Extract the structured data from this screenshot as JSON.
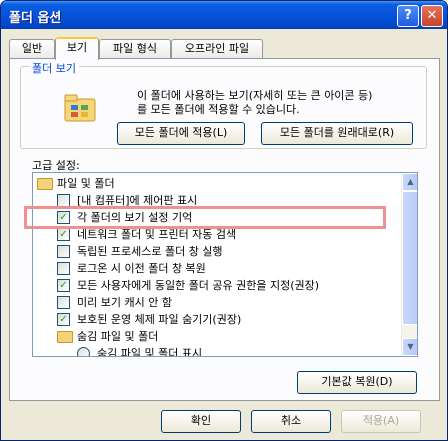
{
  "window": {
    "title": "폴더 옵션",
    "help_label": "?",
    "close_label": "✕"
  },
  "tabs": [
    {
      "label": "일반"
    },
    {
      "label": "보기"
    },
    {
      "label": "파일 형식"
    },
    {
      "label": "오프라인 파일"
    }
  ],
  "folder_views": {
    "title": "폴더 보기",
    "description_line1": "이 폴더에 사용하는 보기(자세히 또는 큰 아이콘 등)",
    "description_line2": "를 모든 폴더에 적용할 수 있습니다.",
    "apply_button": "모든 폴더에 적용(L)",
    "reset_button": "모든 폴더를 원래대로(R)"
  },
  "advanced": {
    "label": "고급 설정:",
    "items": [
      {
        "type": "folder",
        "label": "파일 및 폴더"
      },
      {
        "type": "checkbox",
        "checked": false,
        "label": "[내 컴퓨터]에 제어판 표시"
      },
      {
        "type": "checkbox",
        "checked": true,
        "label": "각 폴더의 보기 설정 기억"
      },
      {
        "type": "checkbox",
        "checked": true,
        "label": "네트워크 폴더 및 프린터 자동 검색"
      },
      {
        "type": "checkbox",
        "checked": false,
        "label": "독립된 프로세스로 폴더 창 실행"
      },
      {
        "type": "checkbox",
        "checked": false,
        "label": "로그온 시 이전 폴더 창 복원"
      },
      {
        "type": "checkbox",
        "checked": true,
        "label": "모든 사용자에게 동일한 폴더 공유 권한을 지정(권장)"
      },
      {
        "type": "checkbox",
        "checked": false,
        "label": "미리 보기 캐시 안 함"
      },
      {
        "type": "checkbox",
        "checked": true,
        "label": "보호된 운영 체제 파일 숨기기(권장)"
      },
      {
        "type": "folder",
        "label": "숨김 파일 및 폴더"
      },
      {
        "type": "radio",
        "checked": false,
        "label": "숨김 파일 및 폴더 표시"
      }
    ],
    "restore_defaults": "기본값 복원(D)"
  },
  "footer": {
    "ok": "확인",
    "cancel": "취소",
    "apply": "적용(A)"
  }
}
